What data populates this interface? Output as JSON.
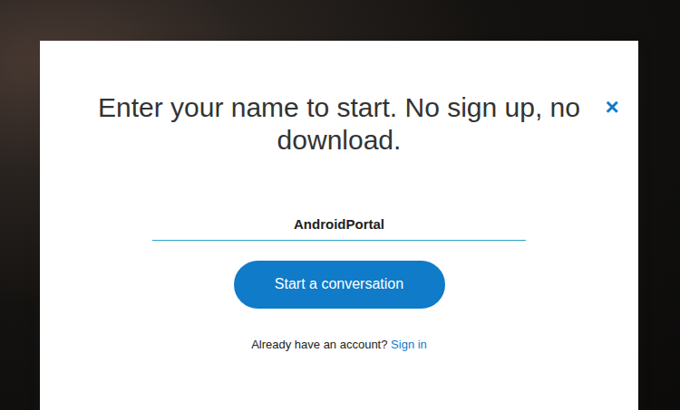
{
  "dialog": {
    "close": "×",
    "heading": "Enter your name to start. No sign up, no download.",
    "name_field": {
      "value": "AndroidPortal"
    },
    "button": "Start a conversation",
    "footer": {
      "text": "Already have an account?",
      "link": "Sign in"
    }
  }
}
